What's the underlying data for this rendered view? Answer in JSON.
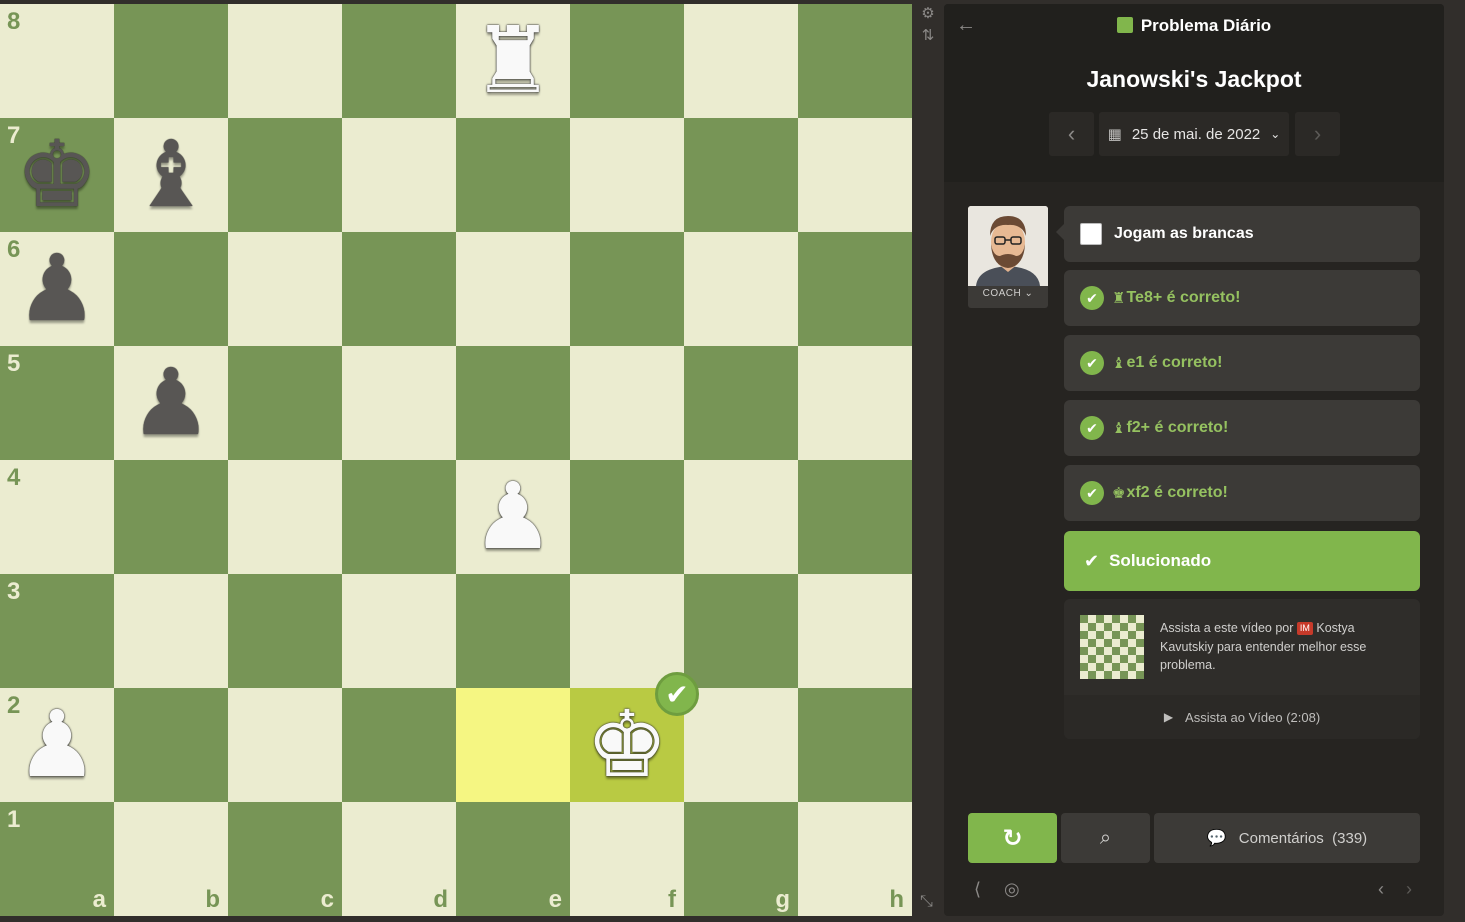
{
  "board": {
    "rank_labels": [
      "8",
      "7",
      "6",
      "5",
      "4",
      "3",
      "2",
      "1"
    ],
    "file_labels": [
      "a",
      "b",
      "c",
      "d",
      "e",
      "f",
      "g",
      "h"
    ],
    "pieces": [
      {
        "square": "e8",
        "glyph": "♜",
        "color": "w",
        "name": "white-rook"
      },
      {
        "square": "a7",
        "glyph": "♚",
        "color": "b",
        "name": "black-king"
      },
      {
        "square": "b7",
        "glyph": "♝",
        "color": "b",
        "name": "black-bishop"
      },
      {
        "square": "a6",
        "glyph": "♟",
        "color": "b",
        "name": "black-pawn"
      },
      {
        "square": "b5",
        "glyph": "♟",
        "color": "b",
        "name": "black-pawn"
      },
      {
        "square": "e4",
        "glyph": "♟",
        "color": "w",
        "name": "white-pawn"
      },
      {
        "square": "a2",
        "glyph": "♟",
        "color": "w",
        "name": "white-pawn"
      },
      {
        "square": "f2",
        "glyph": "♚",
        "color": "w",
        "name": "white-king"
      }
    ],
    "highlighted_squares": [
      "e2",
      "f2"
    ],
    "colors": {
      "light": "#ebecd0",
      "dark": "#779556",
      "highlight_light": "#f5f682",
      "highlight_dark": "#b9ca43"
    },
    "correct_badge": "✔"
  },
  "side_tools": {
    "settings_icon": "⚙",
    "flip_icon": "⇅",
    "resize_icon": "⤡"
  },
  "panel": {
    "header_title": "Problema Diário",
    "puzzle_name": "Janowski's Jackpot",
    "date": "25 de mai. de 2022",
    "prev_icon": "‹",
    "next_icon": "›",
    "back_icon": "←"
  },
  "coach": {
    "label": "COACH ⌄"
  },
  "moves": {
    "turn_text": "Jogam as brancas",
    "items": [
      {
        "piece": "♜",
        "text": "Te8+ é correto!"
      },
      {
        "piece": "♝",
        "text": "e1 é correto!"
      },
      {
        "piece": "♝",
        "text": "f2+ é correto!"
      },
      {
        "piece": "♚",
        "text": "xf2 é correto!"
      }
    ],
    "solved": "Solucionado"
  },
  "video": {
    "text_before": "Assista a este vídeo por",
    "title_badge": "IM",
    "text_after": "Kostya Kavutskiy para entender melhor esse problema.",
    "watch_label": "Assista ao Vídeo (2:08)"
  },
  "buttons": {
    "retry_icon": "↻",
    "analysis_icon": "⌕",
    "comments_label": "Comentários  (339)"
  },
  "accent_color": "#81b64c"
}
